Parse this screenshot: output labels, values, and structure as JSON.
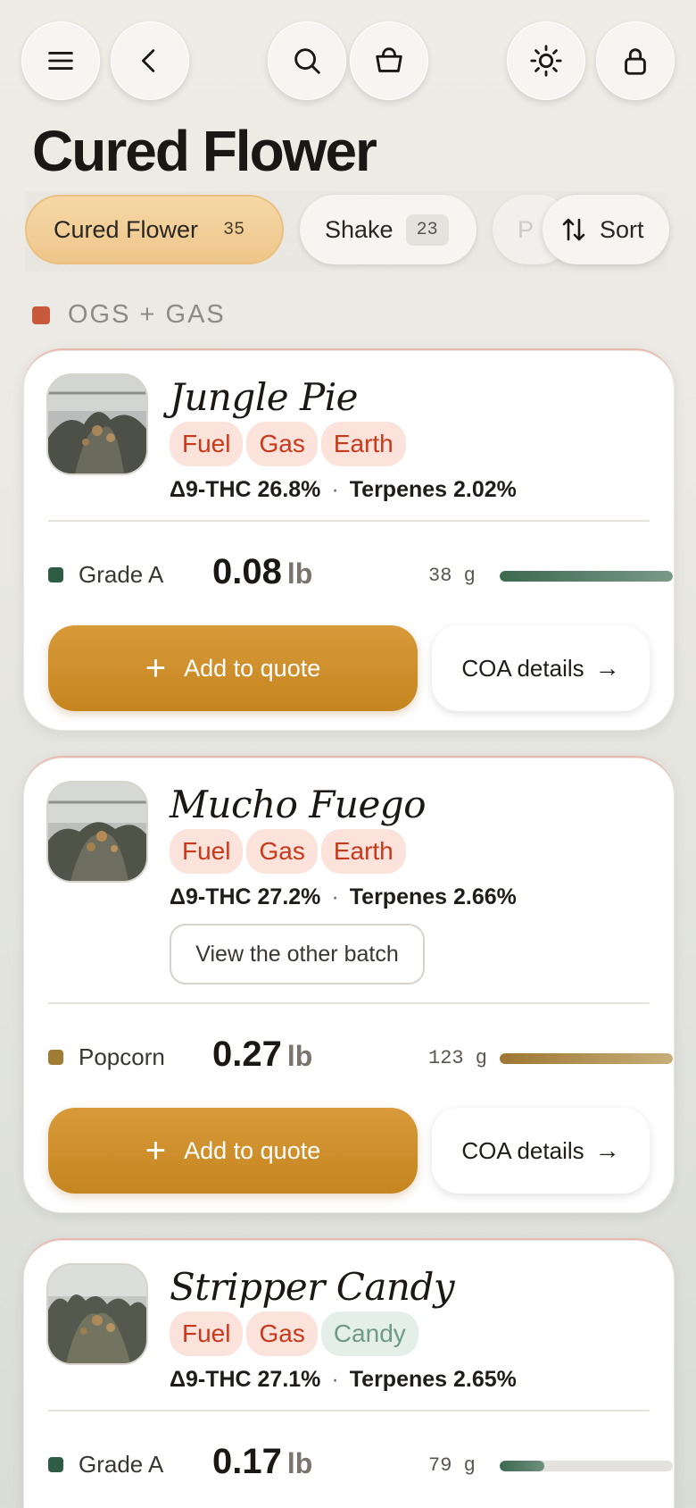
{
  "page": {
    "title": "Cured Flower"
  },
  "toolbar": {
    "buttons": [
      {
        "name": "menu-icon"
      },
      {
        "name": "back-icon"
      },
      {
        "name": "search-icon"
      },
      {
        "name": "cart-icon"
      },
      {
        "name": "theme-icon"
      },
      {
        "name": "lock-icon"
      }
    ]
  },
  "filters": {
    "active": {
      "label": "Cured Flower",
      "count": "35"
    },
    "shake": {
      "label": "Shake",
      "count": "23"
    },
    "partial": {
      "label": "P"
    },
    "sort": {
      "label": "Sort"
    }
  },
  "section": {
    "label": "OGS + GAS",
    "color": "#c9593b"
  },
  "cards": [
    {
      "name": "Jungle Pie",
      "tags": [
        {
          "label": "Fuel",
          "tone": "warm"
        },
        {
          "label": "Gas",
          "tone": "warm"
        },
        {
          "label": "Earth",
          "tone": "warm"
        }
      ],
      "thc": "Δ9-THC 26.8%",
      "terpenes": "Terpenes 2.02%",
      "grade": "Grade A",
      "grade_color": "#2f5d44",
      "weight": "0.08",
      "unit": "lb",
      "grams": "38 g",
      "stock_fraction": 1.0,
      "add_label": "Add to quote",
      "coa_label": "COA details"
    },
    {
      "name": "Mucho Fuego",
      "tags": [
        {
          "label": "Fuel",
          "tone": "warm"
        },
        {
          "label": "Gas",
          "tone": "warm"
        },
        {
          "label": "Earth",
          "tone": "warm"
        }
      ],
      "thc": "Δ9-THC 27.2%",
      "terpenes": "Terpenes 2.66%",
      "batch_label": "View the other batch",
      "grade": "Popcorn",
      "grade_color": "#a07c34",
      "weight": "0.27",
      "unit": "lb",
      "grams": "123 g",
      "stock_fraction": 1.0,
      "add_label": "Add to quote",
      "coa_label": "COA details"
    },
    {
      "name": "Stripper Candy",
      "tags": [
        {
          "label": "Fuel",
          "tone": "warm"
        },
        {
          "label": "Gas",
          "tone": "warm"
        },
        {
          "label": "Candy",
          "tone": "cool"
        }
      ],
      "thc": "Δ9-THC 27.1%",
      "terpenes": "Terpenes 2.65%",
      "grade": "Grade A",
      "grade_color": "#2f5d44",
      "weight": "0.17",
      "unit": "lb",
      "grams": "79 g",
      "stock_fraction": 0.26
    }
  ]
}
